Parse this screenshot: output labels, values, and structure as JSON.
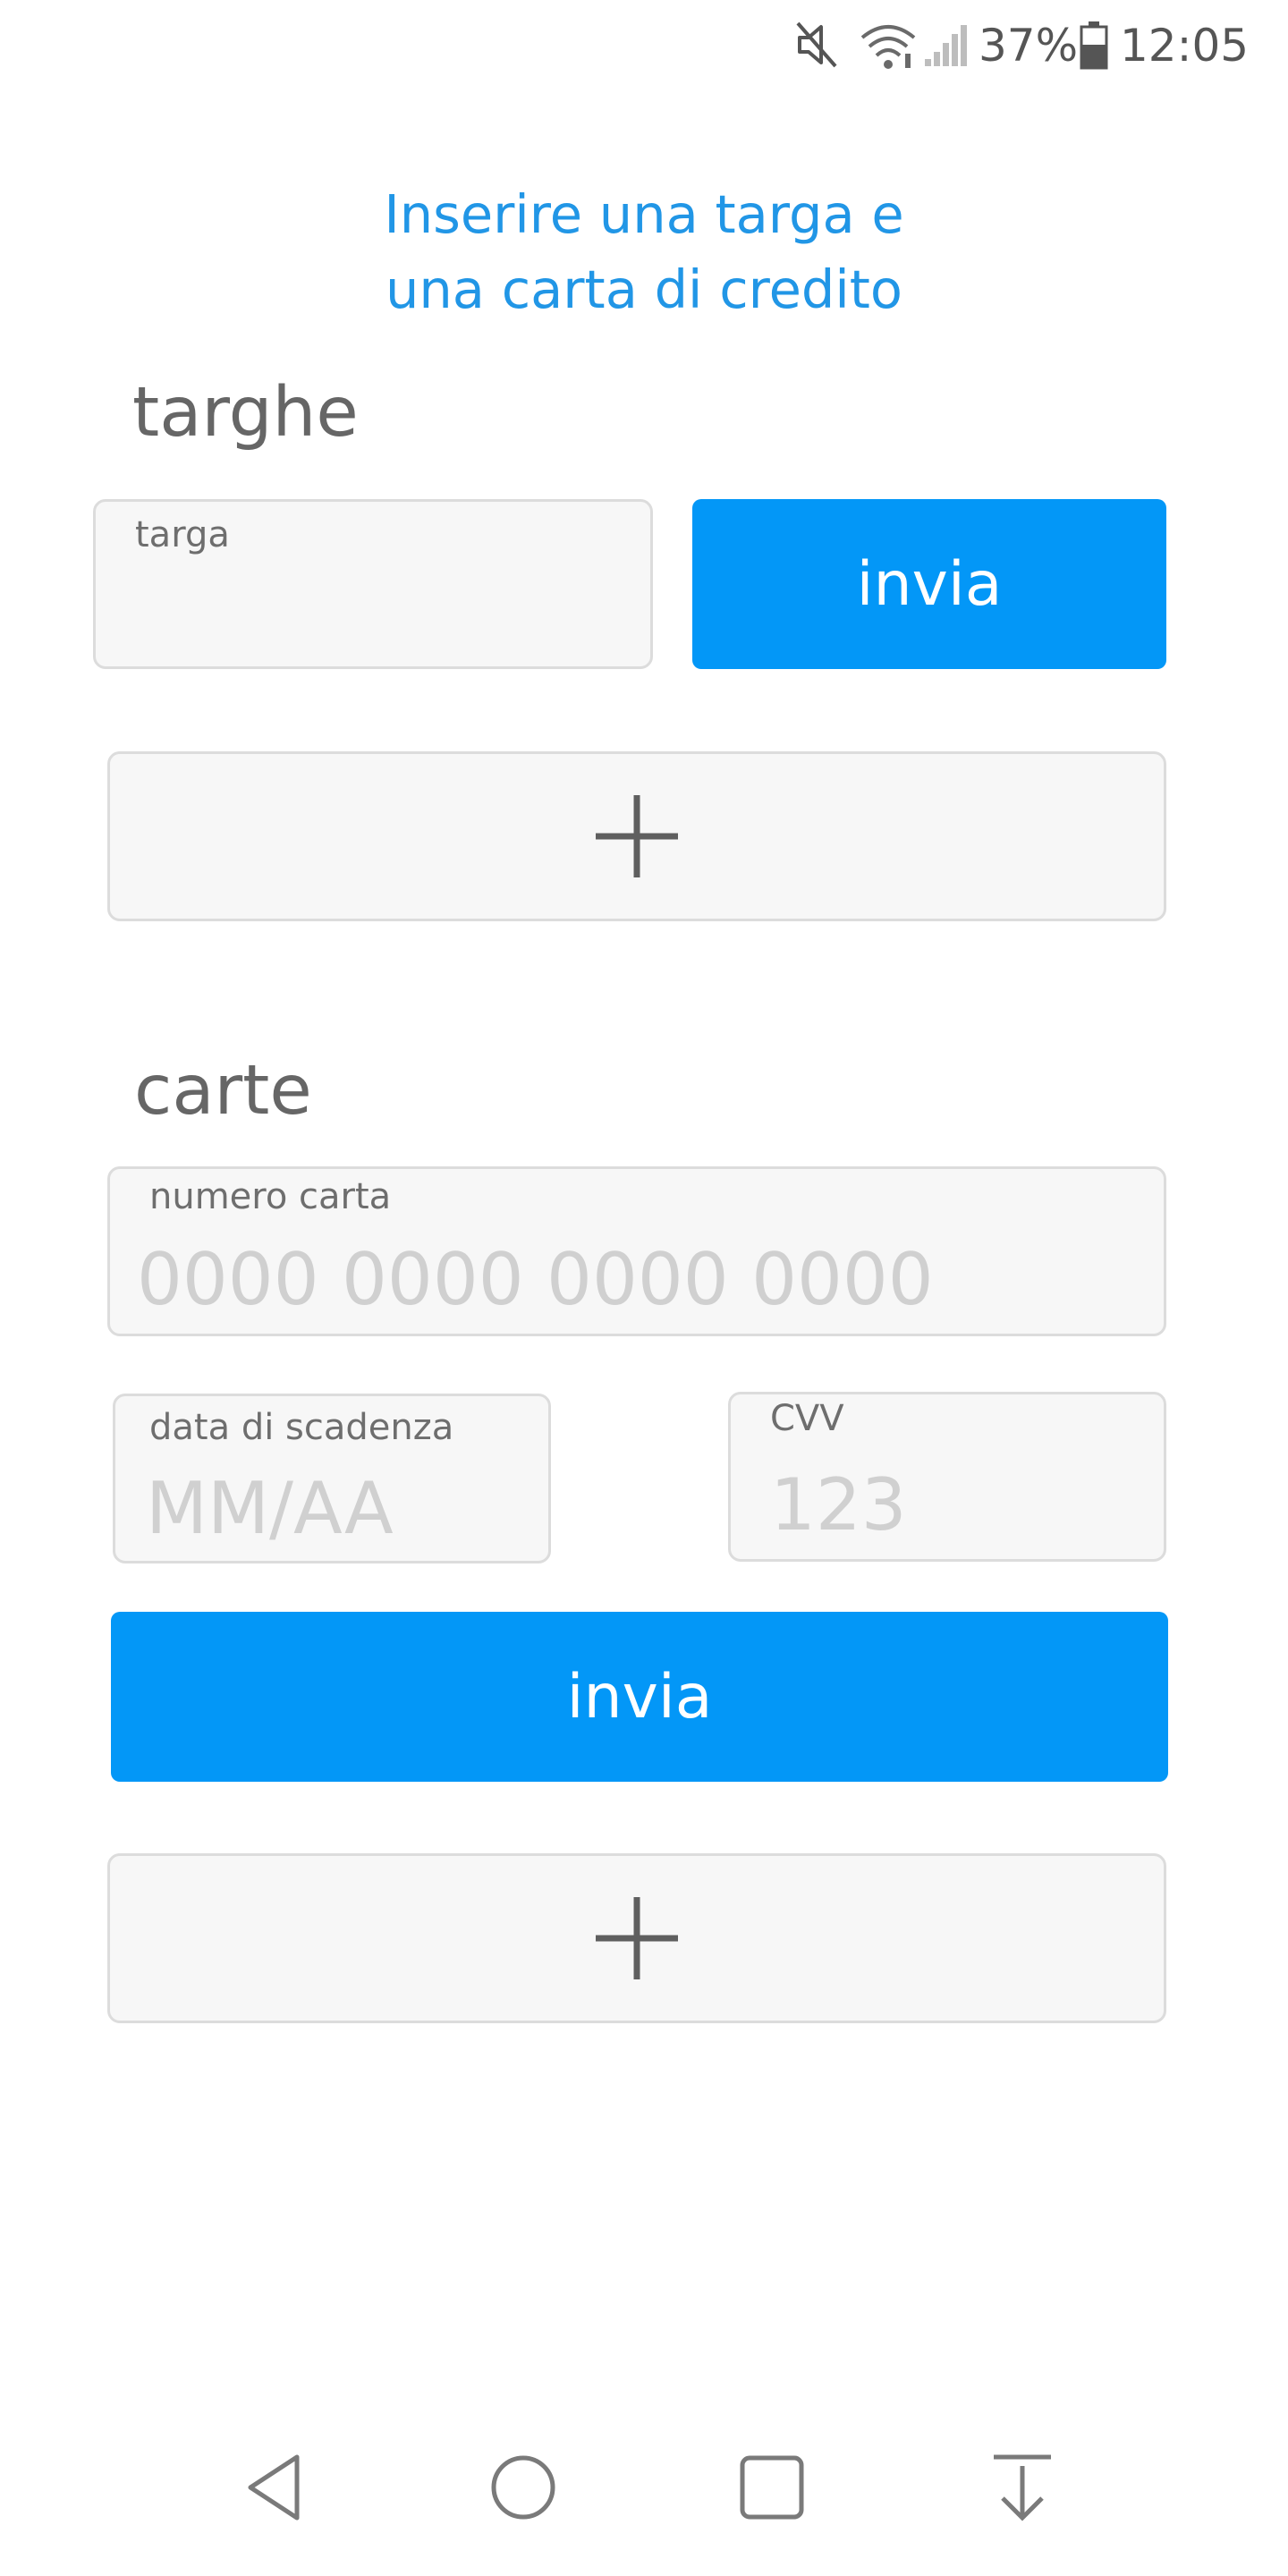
{
  "status_bar": {
    "battery_percent": "37%",
    "time": "12:05",
    "icons": [
      "mute-icon",
      "wifi-icon",
      "signal-icon",
      "battery-icon"
    ]
  },
  "heading": {
    "line1": "Inserire una targa e",
    "line2": "una carta di credito"
  },
  "targhe": {
    "title": "targhe",
    "targa_label": "targa",
    "targa_value": "",
    "send_label": "invia",
    "add_icon": "plus-icon"
  },
  "carte": {
    "title": "carte",
    "numero_label": "numero carta",
    "numero_placeholder": "0000 0000 0000 0000",
    "scadenza_label": "data di scadenza",
    "scadenza_placeholder": "MM/AA",
    "cvv_label": "CVV",
    "cvv_placeholder": "123",
    "send_label": "invia",
    "add_icon": "plus-icon"
  },
  "nav_bar": {
    "icons": [
      "back-icon",
      "home-icon",
      "recents-icon",
      "notification-pull-icon"
    ]
  },
  "colors": {
    "accent": "#0397f7",
    "heading": "#2196e6",
    "field_bg": "#f7f7f7",
    "field_border": "#dcdcdc",
    "text": "#666666",
    "placeholder": "#d0d0d0"
  }
}
